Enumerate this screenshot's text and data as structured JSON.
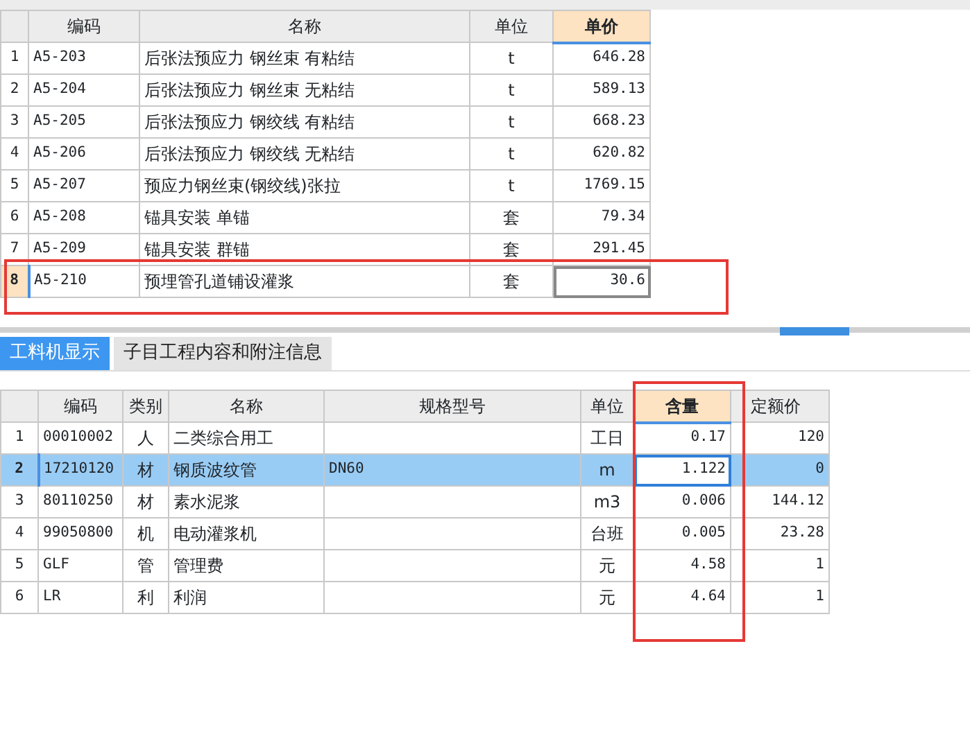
{
  "top_table": {
    "columns": [
      {
        "label": "编码",
        "active": false
      },
      {
        "label": "名称",
        "active": false
      },
      {
        "label": "单位",
        "active": false
      },
      {
        "label": "单价",
        "active": true
      }
    ],
    "rows": [
      {
        "index": "1",
        "code": "A5-203",
        "name": "后张法预应力 钢丝束 有粘结",
        "unit": "t",
        "price": "646.28",
        "selected": false,
        "highlighted": false
      },
      {
        "index": "2",
        "code": "A5-204",
        "name": "后张法预应力 钢丝束 无粘结",
        "unit": "t",
        "price": "589.13",
        "selected": false,
        "highlighted": false
      },
      {
        "index": "3",
        "code": "A5-205",
        "name": "后张法预应力 钢绞线 有粘结",
        "unit": "t",
        "price": "668.23",
        "selected": false,
        "highlighted": false
      },
      {
        "index": "4",
        "code": "A5-206",
        "name": "后张法预应力 钢绞线 无粘结",
        "unit": "t",
        "price": "620.82",
        "selected": false,
        "highlighted": false
      },
      {
        "index": "5",
        "code": "A5-207",
        "name": "预应力钢丝束(钢绞线)张拉",
        "unit": "t",
        "price": "1769.15",
        "selected": false,
        "highlighted": false
      },
      {
        "index": "6",
        "code": "A5-208",
        "name": "锚具安装 单锚",
        "unit": "套",
        "price": "79.34",
        "selected": false,
        "highlighted": false
      },
      {
        "index": "7",
        "code": "A5-209",
        "name": "锚具安装 群锚",
        "unit": "套",
        "price": "291.45",
        "selected": false,
        "highlighted": false
      },
      {
        "index": "8",
        "code": "A5-210",
        "name": "预埋管孔道铺设灌浆",
        "unit": "套",
        "price": "30.6",
        "selected": true,
        "highlighted": true
      }
    ]
  },
  "tabs": [
    {
      "label": "工料机显示",
      "selected": true
    },
    {
      "label": "子目工程内容和附注信息",
      "selected": false
    }
  ],
  "bottom_table": {
    "columns": [
      {
        "label": "编码",
        "active": false,
        "highlighted": false
      },
      {
        "label": "类别",
        "active": false,
        "highlighted": false
      },
      {
        "label": "名称",
        "active": false,
        "highlighted": false
      },
      {
        "label": "规格型号",
        "active": false,
        "highlighted": false
      },
      {
        "label": "单位",
        "active": false,
        "highlighted": false
      },
      {
        "label": "含量",
        "active": true,
        "highlighted": true
      },
      {
        "label": "定额价",
        "active": false,
        "highlighted": false
      }
    ],
    "rows": [
      {
        "index": "1",
        "code": "00010002",
        "category": "人",
        "name": "二类综合用工",
        "spec": "",
        "unit": "工日",
        "quantity": "0.17",
        "price": "120",
        "selected": false
      },
      {
        "index": "2",
        "code": "17210120",
        "category": "材",
        "name": "钢质波纹管",
        "spec": "DN60",
        "unit": "m",
        "quantity": "1.122",
        "price": "0",
        "selected": true
      },
      {
        "index": "3",
        "code": "80110250",
        "category": "材",
        "name": "素水泥浆",
        "spec": "",
        "unit": "m3",
        "quantity": "0.006",
        "price": "144.12",
        "selected": false
      },
      {
        "index": "4",
        "code": "99050800",
        "category": "机",
        "name": "电动灌浆机",
        "spec": "",
        "unit": "台班",
        "quantity": "0.005",
        "price": "23.28",
        "selected": false
      },
      {
        "index": "5",
        "code": "GLF",
        "category": "管",
        "name": "管理费",
        "spec": "",
        "unit": "元",
        "quantity": "4.58",
        "price": "1",
        "selected": false
      },
      {
        "index": "6",
        "code": "LR",
        "category": "利",
        "name": "利润",
        "spec": "",
        "unit": "元",
        "quantity": "4.64",
        "price": "1",
        "selected": false
      }
    ]
  }
}
